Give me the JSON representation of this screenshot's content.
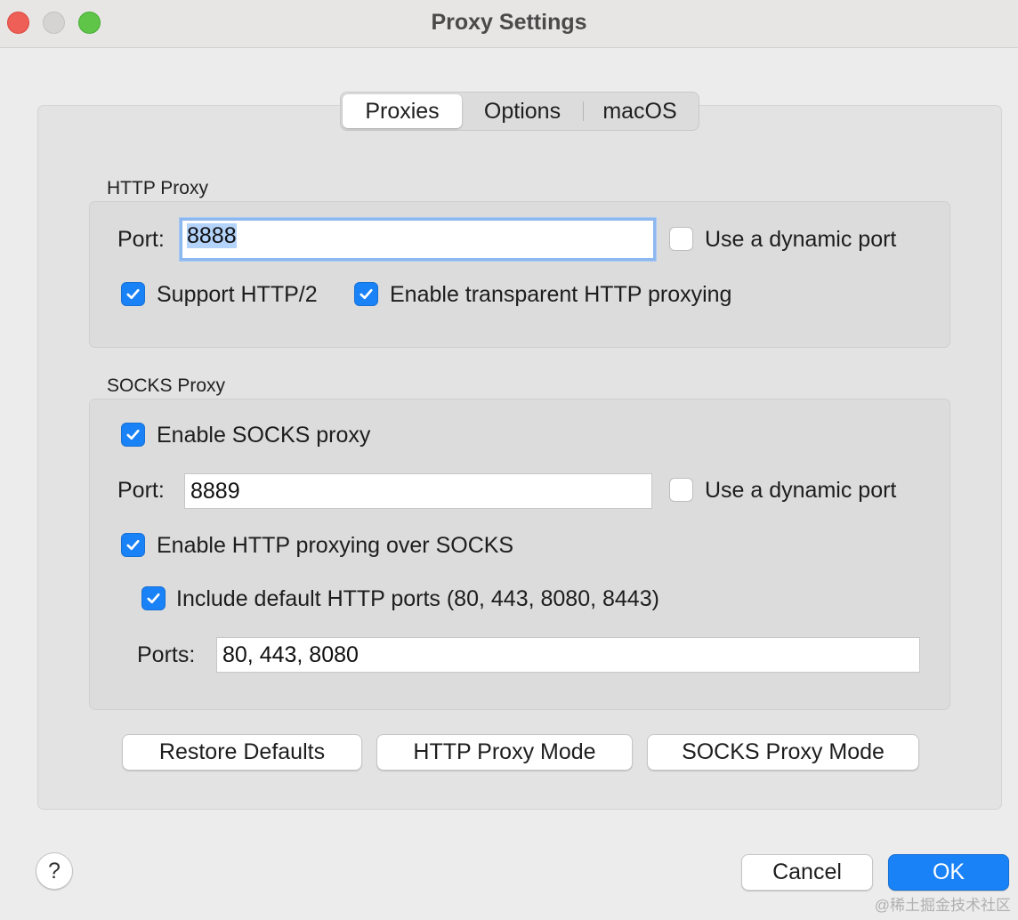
{
  "window": {
    "title": "Proxy Settings"
  },
  "tabs": [
    {
      "label": "Proxies",
      "active": true
    },
    {
      "label": "Options",
      "active": false
    },
    {
      "label": "macOS",
      "active": false
    }
  ],
  "http_proxy": {
    "group_label": "HTTP Proxy",
    "port_label": "Port:",
    "port_value": "8888",
    "dynamic_port_label": "Use a dynamic port",
    "dynamic_port_checked": false,
    "http2_label": "Support HTTP/2",
    "http2_checked": true,
    "transparent_label": "Enable transparent HTTP proxying",
    "transparent_checked": true
  },
  "socks_proxy": {
    "group_label": "SOCKS Proxy",
    "enable_label": "Enable SOCKS proxy",
    "enable_checked": true,
    "port_label": "Port:",
    "port_value": "8889",
    "dynamic_port_label": "Use a dynamic port",
    "dynamic_port_checked": false,
    "http_over_socks_label": "Enable HTTP proxying over SOCKS",
    "http_over_socks_checked": true,
    "include_default_label": "Include default HTTP ports (80, 443, 8080, 8443)",
    "include_default_checked": true,
    "ports_label": "Ports:",
    "ports_value": "80, 443, 8080"
  },
  "actions": {
    "restore_defaults": "Restore Defaults",
    "http_proxy_mode": "HTTP Proxy Mode",
    "socks_proxy_mode": "SOCKS Proxy Mode"
  },
  "footer": {
    "help": "?",
    "cancel": "Cancel",
    "ok": "OK",
    "watermark": "@稀土掘金技术社区"
  },
  "colors": {
    "accent": "#1a82f7",
    "close": "#ee5f57",
    "maximize": "#5ec548"
  }
}
